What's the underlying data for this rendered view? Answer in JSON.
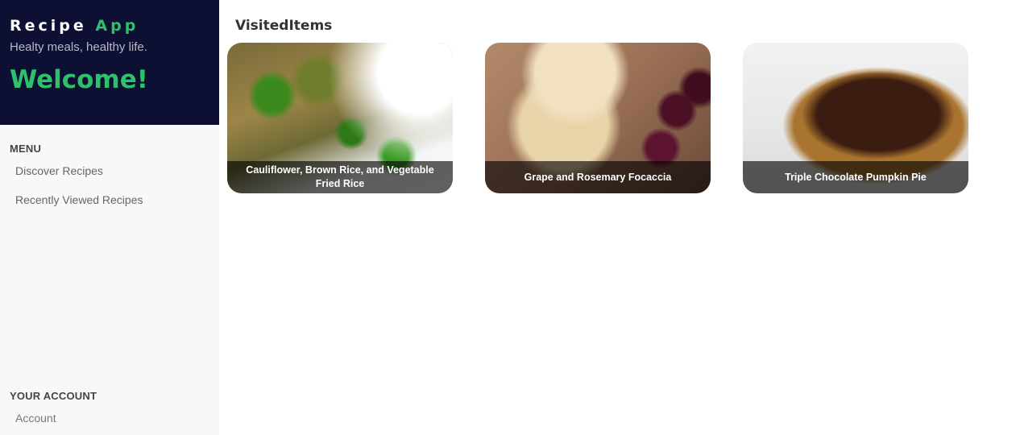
{
  "app": {
    "title_main": "Recipe",
    "title_accent": "App",
    "tagline": "Healty meals, healthy life.",
    "welcome": "Welcome!"
  },
  "menu": {
    "heading": "MENU",
    "items": [
      {
        "label": "Discover Recipes"
      },
      {
        "label": "Recently Viewed Recipes"
      }
    ]
  },
  "account": {
    "heading": "YOUR ACCOUNT",
    "items": [
      {
        "label": "Account"
      }
    ]
  },
  "main": {
    "title": "VisitedItems",
    "cards": [
      {
        "title": "Cauliflower, Brown Rice, and Vegetable Fried Rice",
        "image": "fried-rice-photo"
      },
      {
        "title": "Grape and Rosemary Focaccia",
        "image": "focaccia-photo"
      },
      {
        "title": "Triple Chocolate Pumpkin Pie",
        "image": "chocolate-pie-photo"
      }
    ]
  },
  "colors": {
    "brand_bg": "#0e1033",
    "accent": "#2cc26a",
    "sidebar_bg": "#f7f8fa"
  }
}
